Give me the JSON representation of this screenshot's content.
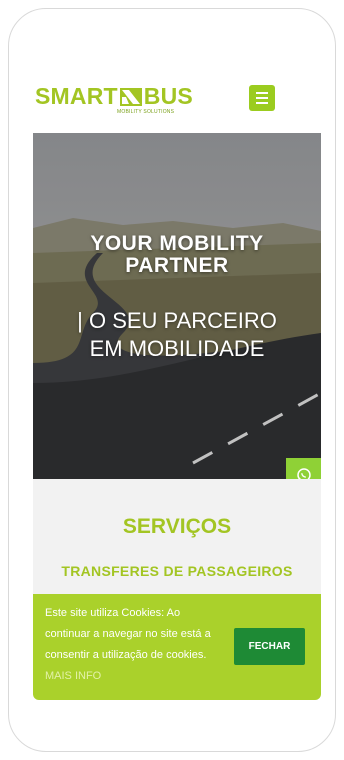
{
  "header": {
    "logo_left": "SMART",
    "logo_right": "BUS",
    "logo_tagline": "MOBILITY SOLUTIONS",
    "menu_icon": "hamburger-menu-icon"
  },
  "hero": {
    "title_line1": "YOUR MOBILITY",
    "title_line2": "PARTNER",
    "subtitle_line1": "| O SEU PARCEIRO",
    "subtitle_line2": "EM MOBILIDADE"
  },
  "side_buttons": {
    "whatsapp_icon": "whatsapp-icon",
    "phone_icon": "phone-icon"
  },
  "services": {
    "title": "SERVIÇOS",
    "subtitle": "TRANSFERES DE PASSAGEIROS"
  },
  "cookie": {
    "text": "Este site utiliza Cookies: Ao continuar a navegar no site está a consentir a utilização de cookies.",
    "link_label": "MAIS INFO",
    "button_label": "FECHAR"
  },
  "colors": {
    "brand_green": "#a3c523",
    "dark_green": "#1e8a35",
    "whatsapp_green": "#8fd136"
  }
}
